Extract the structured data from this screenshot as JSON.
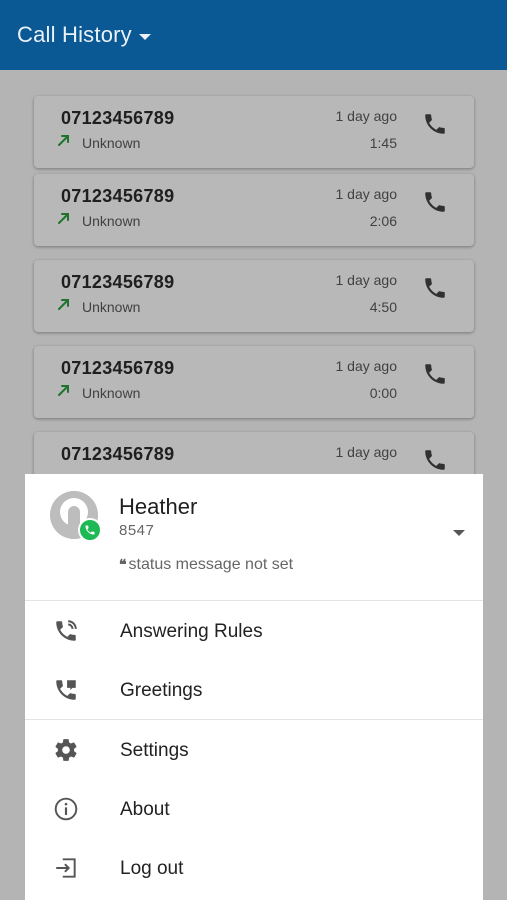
{
  "app_bar": {
    "title": "Call History"
  },
  "calls": [
    {
      "number": "07123456789",
      "name": "Unknown",
      "when": "1 day ago",
      "duration": "1:45"
    },
    {
      "number": "07123456789",
      "name": "Unknown",
      "when": "1 day ago",
      "duration": "2:06"
    },
    {
      "number": "07123456789",
      "name": "Unknown",
      "when": "1 day ago",
      "duration": "4:50"
    },
    {
      "number": "07123456789",
      "name": "Unknown",
      "when": "1 day ago",
      "duration": "0:00"
    },
    {
      "number": "07123456789",
      "name": "",
      "when": "1 day ago",
      "duration": ""
    }
  ],
  "profile": {
    "name": "Heather",
    "extension": "8547",
    "status_message": "status message not set",
    "presence_color": "#1db954"
  },
  "menu": [
    {
      "label": "Answering Rules",
      "icon": "phone-forward-icon"
    },
    {
      "label": "Greetings",
      "icon": "phone-greeting-icon"
    },
    {
      "label": "Settings",
      "icon": "gear-icon"
    },
    {
      "label": "About",
      "icon": "info-icon"
    },
    {
      "label": "Log out",
      "icon": "logout-icon"
    }
  ],
  "colors": {
    "app_bar": "#0a5894",
    "outgoing_arrow": "#2e9e3e"
  }
}
